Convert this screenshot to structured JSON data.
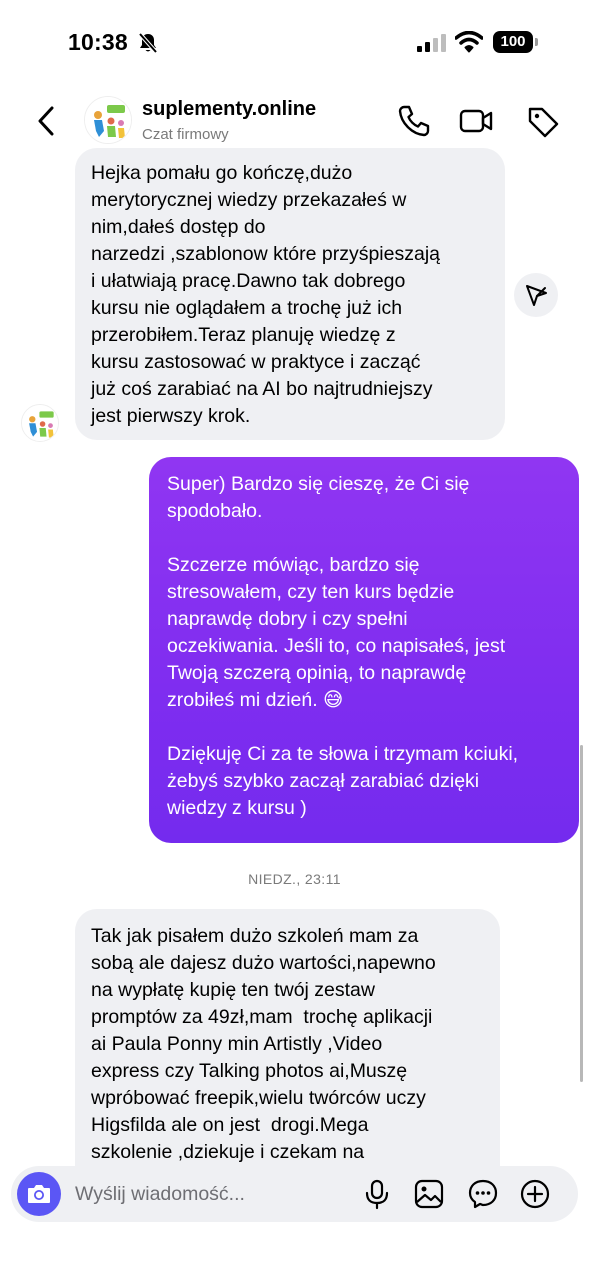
{
  "status_bar": {
    "time": "10:38",
    "battery": "100"
  },
  "header": {
    "name": "suplementy.online",
    "subtitle": "Czat firmowy",
    "icons": [
      "back-chevron-icon",
      "phone-icon",
      "video-camera-icon",
      "tag-icon"
    ]
  },
  "messages": [
    {
      "direction": "incoming",
      "lines": [
        "Hejka pomału go kończę,dużo",
        "merytorycznej wiedzy przekazałeś w",
        "nim,dałeś dostęp do",
        "narzedzi ,szablonow które przyśpieszają",
        "i ułatwiają pracę.Dawno tak dobrego",
        "kursu nie oglądałem a trochę już ich",
        "przerobiłem.Teraz planuję wiedzę z",
        "kursu zastosować w praktyce i zacząć",
        "już coś zarabiać na AI bo najtrudniejszy",
        "jest pierwszy krok."
      ]
    },
    {
      "direction": "outgoing",
      "paragraphs": [
        [
          "Super) Bardzo się cieszę, że Ci się",
          "spodobało."
        ],
        [
          "Szczerze mówiąc, bardzo się",
          "stresowałem, czy ten kurs będzie",
          "naprawdę dobry i czy spełni",
          "oczekiwania. Jeśli to, co napisałeś, jest",
          "Twoją szczerą opinią, to naprawdę",
          "zrobiłeś mi dzień. 😅"
        ],
        [
          "Dziękuję Ci za te słowa i trzymam kciuki,",
          "żebyś szybko zaczął zarabiać dzięki",
          "wiedzy z kursu )"
        ]
      ]
    },
    {
      "direction": "incoming",
      "lines": [
        "Tak jak pisałem dużo szkoleń mam za",
        "sobą ale dajesz dużo wartości,napewno",
        "na wypłatę kupię ten twój zestaw",
        "promptów za 49zł,mam  trochę aplikacji",
        "ai Paula Ponny min Artistly ,Video",
        "express czy Talking photos ai,Muszę",
        "wpróbować freepik,wielu twórców uczy",
        "Higsfilda ale on jest  drogi.Mega",
        "szkolenie ,dziekuje i czekam na"
      ]
    }
  ],
  "timestamp": "NIEDZ., 23:11",
  "composer": {
    "placeholder": "Wyślij wiadomość...",
    "icons": [
      "camera-icon",
      "microphone-icon",
      "gallery-icon",
      "sticker-icon",
      "add-icon"
    ]
  },
  "colors": {
    "outgoing_bubble": "#8431f1",
    "incoming_bubble": "#eff0f3",
    "camera_button": "#5b56f5"
  }
}
